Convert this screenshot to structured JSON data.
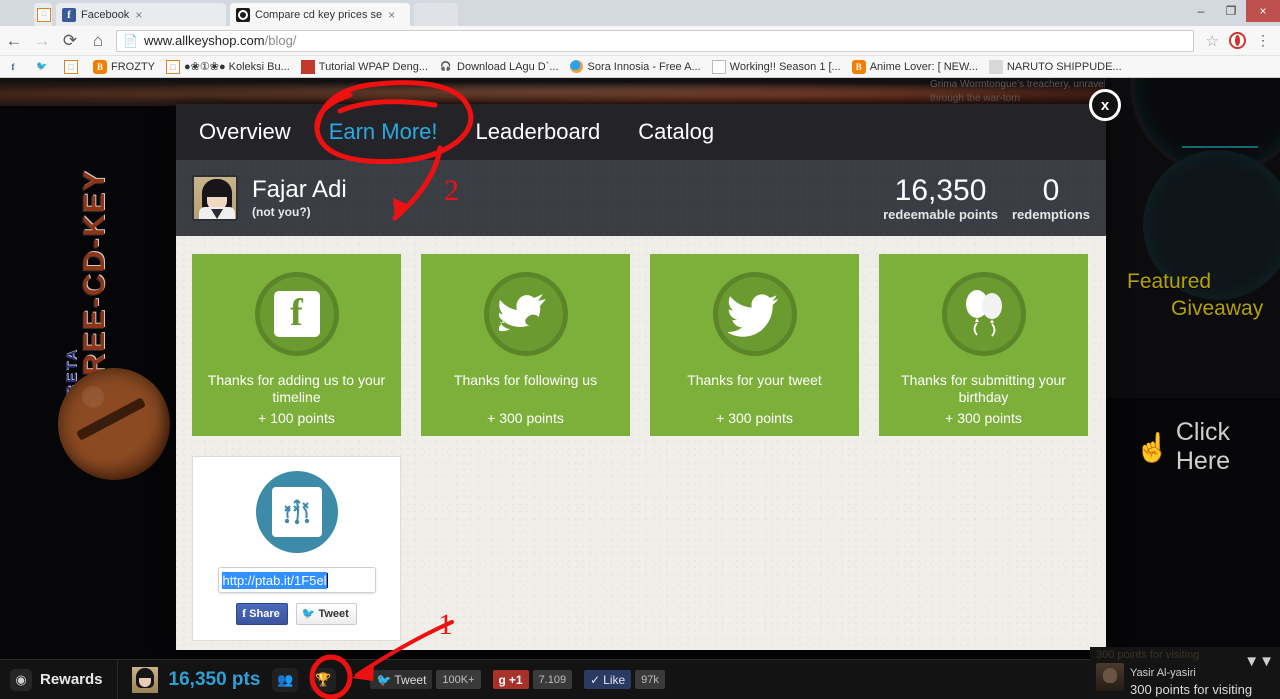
{
  "browser": {
    "tabs": [
      {
        "title": "",
        "favicon": "generic-icon",
        "active": false
      },
      {
        "title": "Facebook",
        "favicon": "facebook-icon",
        "active": false,
        "close": "×"
      },
      {
        "title": "Compare cd key prices se",
        "favicon": "allkeyshop-icon",
        "active": true,
        "close": "×"
      }
    ],
    "window_controls": {
      "minimize": "–",
      "maximize": "❐",
      "close": "×"
    },
    "nav": {
      "back": "←",
      "forward": "→",
      "reload": "⟳",
      "home": "⌂"
    },
    "omnibox": {
      "page_icon": "page-icon",
      "url_host": "www.allkeyshop.com",
      "url_path": "/blog/",
      "star": "☆",
      "extension": "opera-extension-icon",
      "menu": "⋮"
    },
    "bookmarks": [
      {
        "label": "",
        "icon": "facebook-icon"
      },
      {
        "label": "",
        "icon": "twitter-icon"
      },
      {
        "label": "",
        "icon": "generic-box-icon"
      },
      {
        "label": "FROZTY",
        "icon": "blogger-icon"
      },
      {
        "label": "●❀①❀● Koleksi Bu...",
        "icon": "generic-box-icon"
      },
      {
        "label": "Tutorial WPAP Deng...",
        "icon": "wpap-icon"
      },
      {
        "label": "Download LAgu D`...",
        "icon": "headphones-icon"
      },
      {
        "label": "Sora Innosia - Free A...",
        "icon": "sora-icon"
      },
      {
        "label": "Working!! Season 1 [...",
        "icon": "document-icon"
      },
      {
        "label": "Anime Lover: [ NEW...",
        "icon": "blogger-icon"
      },
      {
        "label": "NARUTO SHIPPUDE...",
        "icon": "naruto-icon"
      }
    ]
  },
  "page_background": {
    "hero_text": "Grima Wormtongue's treachery, unravel a mystery weaved through the war-torn",
    "left_badge": {
      "main": "FREE-CD-KEY",
      "beta": "BETA"
    },
    "giveaway": {
      "title_line1": "Featured",
      "title_line2": "Giveaway",
      "cta": "Click Here"
    }
  },
  "modal": {
    "close_label": "x",
    "nav": [
      {
        "label": "Overview",
        "active": false
      },
      {
        "label": "Earn More!",
        "active": true
      },
      {
        "label": "Leaderboard",
        "active": false
      },
      {
        "label": "Catalog",
        "active": false
      }
    ],
    "user": {
      "name": "Fajar Adi",
      "not_you": "(not you?)",
      "avatar": "user-avatar",
      "stats": [
        {
          "value": "16,350",
          "label": "redeemable points"
        },
        {
          "value": "0",
          "label": "redemptions"
        }
      ]
    },
    "cards": [
      {
        "icon": "facebook-icon",
        "text": "Thanks for adding us to your timeline",
        "points": "+ 100 points"
      },
      {
        "icon": "twitter-follow-bird-icon",
        "text": "Thanks for following us",
        "points": "+ 300 points"
      },
      {
        "icon": "twitter-icon",
        "text": "Thanks for your tweet",
        "points": "+ 300 points"
      },
      {
        "icon": "balloons-icon",
        "text": "Thanks for submitting your birthday",
        "points": "+ 300 points"
      }
    ],
    "share_card": {
      "icon": "share-network-icon",
      "url_value": "http://ptab.it/1F5el",
      "url_placeholder": "http://ptab.it/",
      "facebook_button": "Share",
      "twitter_button": "Tweet"
    }
  },
  "bottom_bar": {
    "rewards_icon": "rewards-badge-icon",
    "rewards_label": "Rewards",
    "user_avatar": "user-avatar",
    "points": "16,350 pts",
    "friends_icon": "friends-icon",
    "trophy_icon": "trophy-icon",
    "social": [
      {
        "type": "twitter",
        "label": "Tweet",
        "count": "100K+"
      },
      {
        "type": "googleplus",
        "label": "+1",
        "count": "7.109"
      },
      {
        "type": "facebook",
        "label": "Like",
        "count": "97k"
      }
    ],
    "notification": {
      "previous": "300 points for visiting",
      "name": "Yasir Al-yasiri",
      "text": "300 points for visiting",
      "chevron": "»"
    }
  },
  "annotations": {
    "marker_1": "1",
    "marker_2": "2",
    "color": "#ee1111"
  }
}
